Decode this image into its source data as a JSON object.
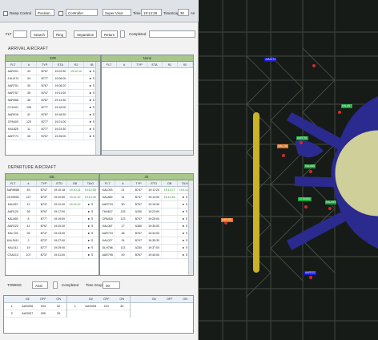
{
  "topbar": {
    "ramp_control": "Ramp Control",
    "position_value": "Position",
    "controller_value": "Controller",
    "role_value": "Super Visor",
    "time_label": "Time",
    "time_value": "19:14:28",
    "timescope_label": "TimeScope",
    "timescope_value": "30",
    "extra": "Ari"
  },
  "search": {
    "flt_label": "FLT",
    "search_button": "Search",
    "ring_button": "Ring",
    "separation_button": "Separation",
    "return_button": "Return",
    "completed_label": "Completed"
  },
  "arrival": {
    "title": "ARRIVAL AIRCRAFT",
    "left_head": "33R",
    "right_head": "None",
    "columns": [
      "FLT",
      "#",
      "TYP",
      "ETA",
      "RJ",
      "IB"
    ],
    "rows": [
      [
        "AAR201",
        "43",
        "B767",
        "19:03:30",
        "19:12:10",
        "► S"
      ],
      [
        "JJA1474",
        "34",
        "B777",
        "19:06:00",
        "",
        "► S"
      ],
      [
        "AAR751",
        "30",
        "B767",
        "19:08:20",
        "",
        "► S"
      ],
      [
        "AAR757",
        "35",
        "B747",
        "19:11:00",
        "",
        "► S"
      ],
      [
        "AAR566",
        "36",
        "B767",
        "19:13:30",
        "",
        "► S"
      ],
      [
        "CCA101",
        "105",
        "B777",
        "19:16:00",
        "",
        "► S"
      ],
      [
        "AAR016",
        "41",
        "B767",
        "19:18:30",
        "",
        "► S"
      ],
      [
        "CPA400",
        "125",
        "B777",
        "19:21:00",
        "",
        "► S"
      ],
      [
        "KAL825",
        "11",
        "B777",
        "19:23:30",
        "",
        "► S"
      ],
      [
        "AAR771",
        "46",
        "B767",
        "19:26:00",
        "",
        "► S"
      ]
    ]
  },
  "departure": {
    "title": "DEPARTURE AIRCRAFT",
    "left_head": "33L",
    "right_head": "34",
    "columns": [
      "FLT",
      "#",
      "TYP",
      "ETD",
      "OB",
      "TAXI"
    ],
    "left_rows": [
      [
        "AAR8986",
        "45",
        "B747",
        "19:10:18",
        "19:10:14",
        "19:12:05"
      ],
      [
        "CES5052",
        "127",
        "B737",
        "19:10:50",
        "19:11:10",
        "19:13:43"
      ],
      [
        "KAL657",
        "11",
        "B737",
        "19:12:40",
        "19:13:12",
        "► S"
      ],
      [
        "AAR120",
        "36",
        "B767",
        "19:17:00",
        "",
        "► S"
      ],
      [
        "KAL665",
        "8",
        "B777",
        "19:19:00",
        "",
        "► S"
      ],
      [
        "AAR222",
        "41",
        "B767",
        "19:20:00",
        "",
        "► S"
      ],
      [
        "KAL726",
        "26",
        "B747",
        "19:23:00",
        "",
        "► S"
      ],
      [
        "KAL3411",
        "2",
        "B737",
        "19:27:00",
        "",
        "► S"
      ],
      [
        "KAL011",
        "19",
        "B777",
        "19:29:00",
        "",
        "► S"
      ],
      [
        "CSA213",
        "107",
        "B737",
        "19:31:00",
        "",
        "► S"
      ]
    ],
    "right_rows": [
      [
        "KAL093",
        "21",
        "B747",
        "19:11:20",
        "19:11:27",
        "19:14:28"
      ],
      [
        "KAL869",
        "31",
        "B747",
        "19:14:00",
        "19:14:16",
        "► S"
      ],
      [
        "AAR733",
        "50",
        "B767",
        "19:15:30",
        "",
        "► S"
      ],
      [
        "THA627",
        "125",
        "A330",
        "19:23:00",
        "",
        "► S"
      ],
      [
        "CPA418",
        "123",
        "B747",
        "19:25:00",
        "",
        "► S"
      ],
      [
        "KAL087",
        "17",
        "A380",
        "19:30:00",
        "",
        "► S"
      ],
      [
        "AAR723",
        "48",
        "B767",
        "19:34:00",
        "",
        "► S"
      ],
      [
        "KAL027",
        "24",
        "B747",
        "19:35:30",
        "",
        "► S"
      ],
      [
        "DLH766",
        "113",
        "A330",
        "19:37:00",
        "",
        "► S"
      ],
      [
        "AAR795",
        "49",
        "B767",
        "19:40:00",
        "",
        "► S"
      ]
    ]
  },
  "towing": {
    "label": "TOWING",
    "value": "ASG",
    "completed_label": "Completed",
    "timescope_label": "Time Scope",
    "timescope_value": "30",
    "columns": [
      "",
      "G#",
      "OFF",
      "ON"
    ],
    "left_rows": [
      [
        "1",
        "AAS006",
        "204",
        "32"
      ],
      [
        "2",
        "AAS007",
        "205",
        "25"
      ]
    ],
    "mid_rows": [
      [
        "1",
        "AAS005",
        "210",
        "39"
      ]
    ]
  },
  "map_tags": [
    {
      "text": "JJA1474",
      "color": "#1a1ae0"
    },
    {
      "text": "KAL657",
      "color": "#16a83a"
    },
    {
      "text": "KAL726",
      "color": "#e8731e"
    },
    {
      "text": "AAR751",
      "color": "#16a83a"
    },
    {
      "text": "KAL665",
      "color": "#16a83a"
    },
    {
      "text": "CES5052",
      "color": "#16a83a"
    },
    {
      "text": "KAL093",
      "color": "#16a83a"
    },
    {
      "text": "AAR201",
      "color": "#e8731e"
    },
    {
      "text": "AAR222",
      "color": "#1a1ae0"
    }
  ]
}
